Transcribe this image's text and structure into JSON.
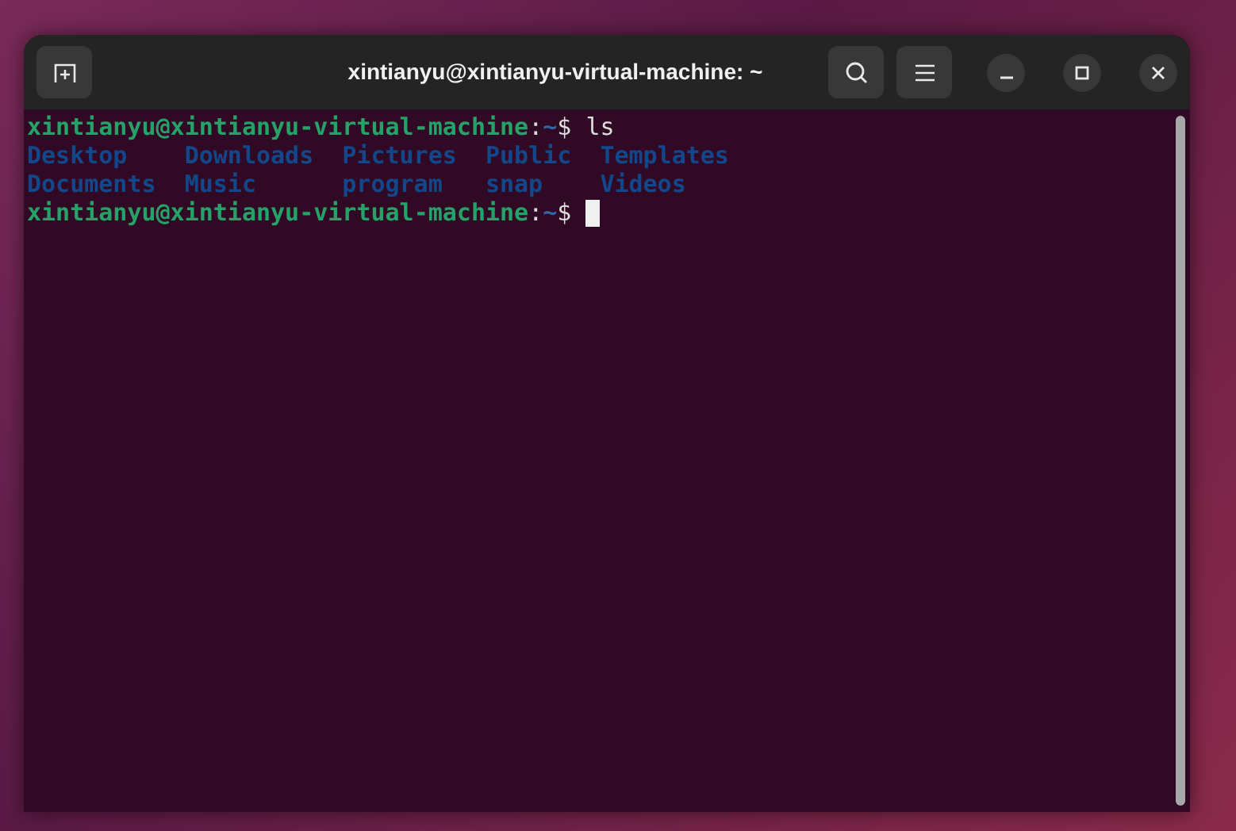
{
  "window": {
    "title": "xintianyu@xintianyu-virtual-machine: ~"
  },
  "terminal": {
    "lines": [
      {
        "kind": "prompt",
        "user_host": "xintianyu@xintianyu-virtual-machine",
        "separator": ":",
        "path": "~",
        "symbol": "$",
        "command": "ls",
        "cursor": false
      },
      {
        "kind": "listing",
        "entries": [
          "Desktop",
          "Downloads",
          "Pictures",
          "Public",
          "Templates"
        ]
      },
      {
        "kind": "listing",
        "entries": [
          "Documents",
          "Music",
          "program",
          "snap",
          "Videos"
        ]
      },
      {
        "kind": "prompt",
        "user_host": "xintianyu@xintianyu-virtual-machine",
        "separator": ":",
        "path": "~",
        "symbol": "$",
        "cursor": true
      }
    ]
  }
}
